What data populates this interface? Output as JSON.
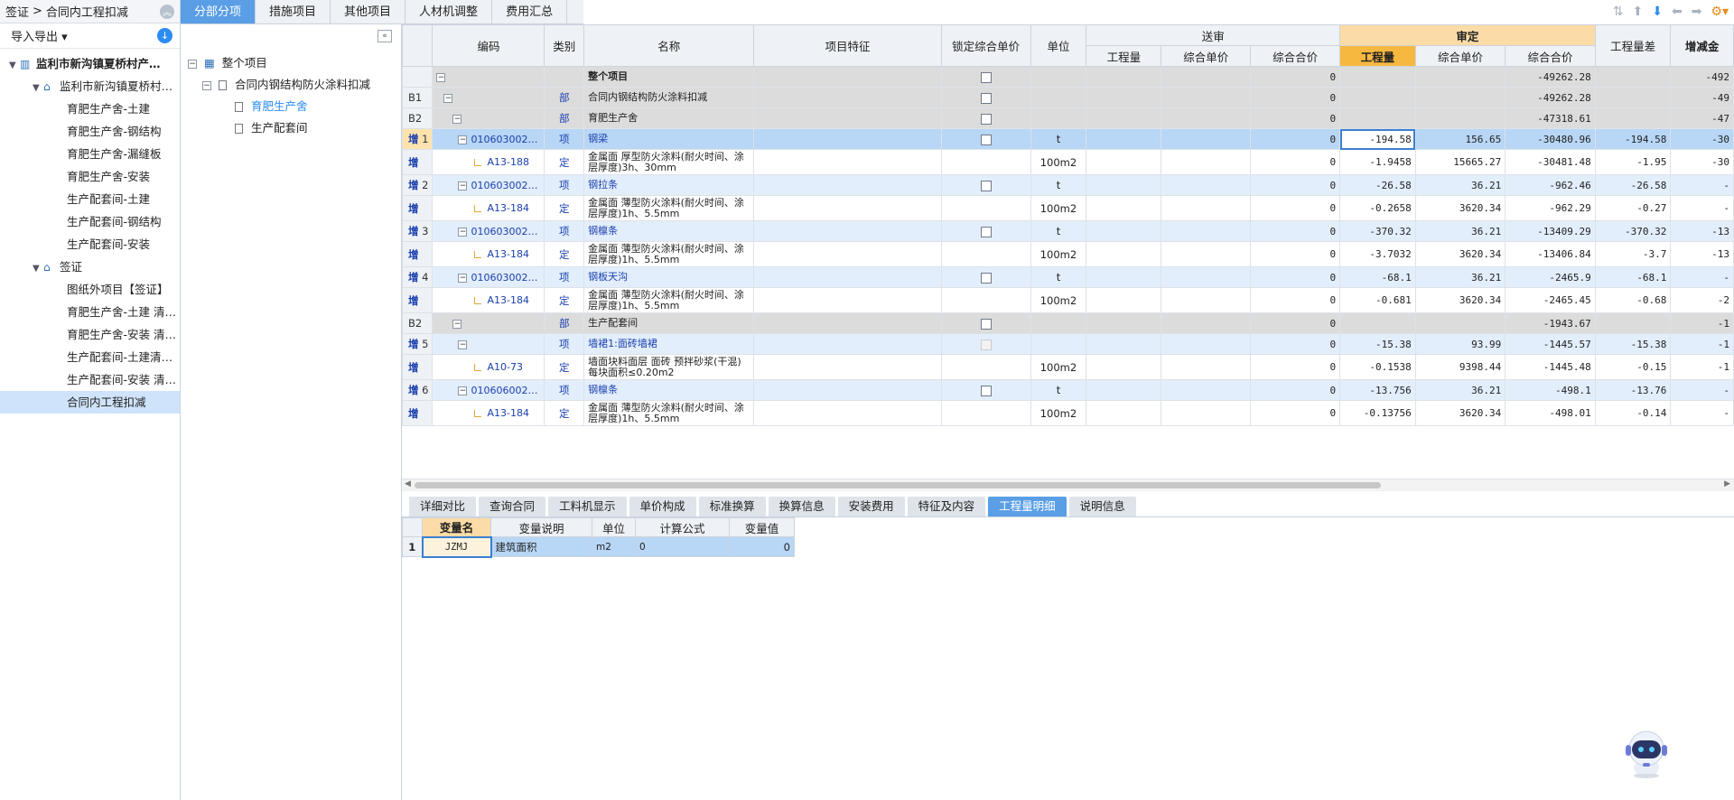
{
  "breadcrumb": {
    "root": "签证",
    "sep": ">",
    "current": "合同内工程扣减"
  },
  "left_panel": {
    "import_export": "导入导出",
    "tree": [
      {
        "label": "监利市新沟镇夏桥村产…",
        "level": 0,
        "bold": true
      },
      {
        "label": "监利市新沟镇夏桥村…",
        "level": 1
      },
      {
        "label": "育肥生产舍-土建",
        "level": 2
      },
      {
        "label": "育肥生产舍-钢结构",
        "level": 2
      },
      {
        "label": "育肥生产舍-漏缝板",
        "level": 2
      },
      {
        "label": "育肥生产舍-安装",
        "level": 2
      },
      {
        "label": "生产配套间-土建",
        "level": 2
      },
      {
        "label": "生产配套间-钢结构",
        "level": 2
      },
      {
        "label": "生产配套间-安装",
        "level": 2
      },
      {
        "label": "签证",
        "level": 1
      },
      {
        "label": "图纸外项目【签证】",
        "level": 2
      },
      {
        "label": "育肥生产舍-土建 清…",
        "level": 2
      },
      {
        "label": "育肥生产舍-安装 清…",
        "level": 2
      },
      {
        "label": "生产配套间-土建清…",
        "level": 2
      },
      {
        "label": "生产配套间-安装 清…",
        "level": 2
      },
      {
        "label": "合同内工程扣减",
        "level": 2,
        "selected": true
      }
    ]
  },
  "tabs": [
    "分部分项",
    "措施项目",
    "其他项目",
    "人材机调整",
    "费用汇总"
  ],
  "active_tab": 0,
  "mid_tree": {
    "root": "整个项目",
    "child": "合同内钢结构防火涂料扣减",
    "items": [
      "育肥生产舍",
      "生产配套间"
    ]
  },
  "grid": {
    "headers": {
      "code": "编码",
      "type": "类别",
      "name": "名称",
      "feature": "项目特征",
      "lock": "锁定综合单价",
      "unit": "单位",
      "sent": "送审",
      "sent_qty": "工程量",
      "sent_price": "综合单价",
      "sent_total": "综合合价",
      "review": "审定",
      "rev_qty": "工程量",
      "rev_price": "综合单价",
      "rev_total": "综合合价",
      "diff": "工程量差",
      "inc": "增减金"
    },
    "rows": [
      {
        "rn": "",
        "tag": "",
        "code": "",
        "type": "",
        "name": "整个项目",
        "lock": true,
        "unit": "",
        "sent_total": "0",
        "rev_qty": "",
        "rev_price": "",
        "rev_total": "-49262.28",
        "diff": "",
        "inc": "-492",
        "style": "gray bold",
        "depth": 0,
        "box": true
      },
      {
        "rn": "B1",
        "tag": "",
        "code": "",
        "type": "部",
        "name": "合同内钢结构防火涂料扣减",
        "lock": true,
        "unit": "",
        "sent_total": "0",
        "rev_qty": "",
        "rev_price": "",
        "rev_total": "-49262.28",
        "diff": "",
        "inc": "-49",
        "style": "gray",
        "depth": 1,
        "box": true
      },
      {
        "rn": "B2",
        "tag": "",
        "code": "",
        "type": "部",
        "name": "育肥生产舍",
        "lock": true,
        "unit": "",
        "sent_total": "0",
        "rev_qty": "",
        "rev_price": "",
        "rev_total": "-47318.61",
        "diff": "",
        "inc": "-47",
        "style": "gray",
        "depth": 2,
        "box": true
      },
      {
        "rn": "1",
        "tag": "增",
        "code": "010603002…",
        "type": "项",
        "name": "钢梁",
        "lock": true,
        "unit": "t",
        "sent_total": "0",
        "rev_qty": "-194.58",
        "rev_price": "156.65",
        "rev_total": "-30480.96",
        "diff": "-194.58",
        "inc": "-30",
        "style": "sel",
        "depth": 3,
        "box": true
      },
      {
        "rn": "",
        "tag": "增",
        "code": "A13-188",
        "type": "定",
        "name": "金属面 厚型防火涂料(耐火时间、涂层厚度)3h、30mm",
        "lock": false,
        "unit": "100m2",
        "sent_total": "0",
        "rev_qty": "-1.9458",
        "rev_price": "15665.27",
        "rev_total": "-30481.48",
        "diff": "-1.95",
        "inc": "-30",
        "style": "sub",
        "depth": 4,
        "box": false
      },
      {
        "rn": "2",
        "tag": "增",
        "code": "010603002…",
        "type": "项",
        "name": "钢拉条",
        "lock": true,
        "unit": "t",
        "sent_total": "0",
        "rev_qty": "-26.58",
        "rev_price": "36.21",
        "rev_total": "-962.46",
        "diff": "-26.58",
        "inc": "-",
        "style": "blue",
        "depth": 3,
        "box": true
      },
      {
        "rn": "",
        "tag": "增",
        "code": "A13-184",
        "type": "定",
        "name": "金属面 薄型防火涂料(耐火时间、涂层厚度)1h、5.5mm",
        "lock": false,
        "unit": "100m2",
        "sent_total": "0",
        "rev_qty": "-0.2658",
        "rev_price": "3620.34",
        "rev_total": "-962.29",
        "diff": "-0.27",
        "inc": "-",
        "style": "sub",
        "depth": 4,
        "box": false
      },
      {
        "rn": "3",
        "tag": "增",
        "code": "010603002…",
        "type": "项",
        "name": "钢檩条",
        "lock": true,
        "unit": "t",
        "sent_total": "0",
        "rev_qty": "-370.32",
        "rev_price": "36.21",
        "rev_total": "-13409.29",
        "diff": "-370.32",
        "inc": "-13",
        "style": "blue",
        "depth": 3,
        "box": true
      },
      {
        "rn": "",
        "tag": "增",
        "code": "A13-184",
        "type": "定",
        "name": "金属面 薄型防火涂料(耐火时间、涂层厚度)1h、5.5mm",
        "lock": false,
        "unit": "100m2",
        "sent_total": "0",
        "rev_qty": "-3.7032",
        "rev_price": "3620.34",
        "rev_total": "-13406.84",
        "diff": "-3.7",
        "inc": "-13",
        "style": "sub",
        "depth": 4,
        "box": false
      },
      {
        "rn": "4",
        "tag": "增",
        "code": "010603002…",
        "type": "项",
        "name": "钢板天沟",
        "lock": true,
        "unit": "t",
        "sent_total": "0",
        "rev_qty": "-68.1",
        "rev_price": "36.21",
        "rev_total": "-2465.9",
        "diff": "-68.1",
        "inc": "-",
        "style": "blue",
        "depth": 3,
        "box": true
      },
      {
        "rn": "",
        "tag": "增",
        "code": "A13-184",
        "type": "定",
        "name": "金属面 薄型防火涂料(耐火时间、涂层厚度)1h、5.5mm",
        "lock": false,
        "unit": "100m2",
        "sent_total": "0",
        "rev_qty": "-0.681",
        "rev_price": "3620.34",
        "rev_total": "-2465.45",
        "diff": "-0.68",
        "inc": "-2",
        "style": "sub",
        "depth": 4,
        "box": false
      },
      {
        "rn": "B2",
        "tag": "",
        "code": "",
        "type": "部",
        "name": "生产配套间",
        "lock": true,
        "unit": "",
        "sent_total": "0",
        "rev_qty": "",
        "rev_price": "",
        "rev_total": "-1943.67",
        "diff": "",
        "inc": "-1",
        "style": "gray",
        "depth": 2,
        "box": true
      },
      {
        "rn": "5",
        "tag": "增",
        "code": "",
        "type": "项",
        "name": "墙裙1:面砖墙裙",
        "lock": "disabled",
        "unit": "",
        "sent_total": "0",
        "rev_qty": "-15.38",
        "rev_price": "93.99",
        "rev_total": "-1445.57",
        "diff": "-15.38",
        "inc": "-1",
        "style": "blue",
        "depth": 3,
        "box": true
      },
      {
        "rn": "",
        "tag": "增",
        "code": "A10-73",
        "type": "定",
        "name": "墙面块料面层 面砖 预拌砂浆(干混) 每块面积≤0.20m2",
        "lock": false,
        "unit": "100m2",
        "sent_total": "0",
        "rev_qty": "-0.1538",
        "rev_price": "9398.44",
        "rev_total": "-1445.48",
        "diff": "-0.15",
        "inc": "-1",
        "style": "sub",
        "depth": 4,
        "box": false
      },
      {
        "rn": "6",
        "tag": "增",
        "code": "010606002…",
        "type": "项",
        "name": "钢檩条",
        "lock": true,
        "unit": "t",
        "sent_total": "0",
        "rev_qty": "-13.756",
        "rev_price": "36.21",
        "rev_total": "-498.1",
        "diff": "-13.76",
        "inc": "-",
        "style": "blue",
        "depth": 3,
        "box": true
      },
      {
        "rn": "",
        "tag": "增",
        "code": "A13-184",
        "type": "定",
        "name": "金属面 薄型防火涂料(耐火时间、涂层厚度)1h、5.5mm",
        "lock": false,
        "unit": "100m2",
        "sent_total": "0",
        "rev_qty": "-0.13756",
        "rev_price": "3620.34",
        "rev_total": "-498.01",
        "diff": "-0.14",
        "inc": "-",
        "style": "sub",
        "depth": 4,
        "box": false
      }
    ]
  },
  "bottom_tabs": [
    "详细对比",
    "查询合同",
    "工料机显示",
    "单价构成",
    "标准换算",
    "换算信息",
    "安装费用",
    "特征及内容",
    "工程量明细",
    "说明信息"
  ],
  "active_bottom_tab": 8,
  "var_table": {
    "headers": [
      "变量名",
      "变量说明",
      "单位",
      "计算公式",
      "变量值"
    ],
    "rows": [
      {
        "rn": "1",
        "name": "JZMJ",
        "desc": "建筑面积",
        "unit": "m2",
        "formula": "0",
        "value": "0"
      }
    ]
  },
  "colors": {
    "accent": "#5a9ee6",
    "review_header": "#f7b83f",
    "selected_row": "#b8d6f5",
    "gray_row": "#dcdcdc",
    "blue_row": "#e2eefc"
  }
}
